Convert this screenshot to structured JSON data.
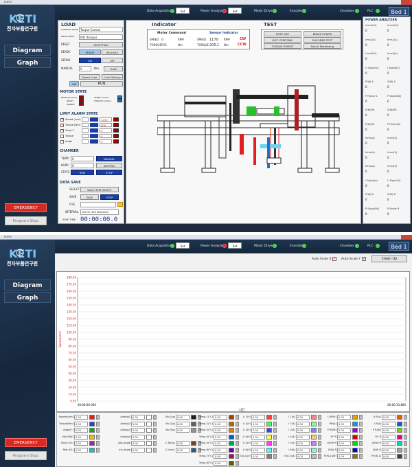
{
  "app": {
    "bed": "Bed 1"
  },
  "status": [
    {
      "label": "Data Acquisition",
      "set": "Set",
      "dot": "g"
    },
    {
      "label": "Power Analyzer",
      "set": "Set",
      "dot": "r"
    },
    {
      "label": "Motor Driver",
      "dot": "g"
    },
    {
      "label": "Encoder",
      "dot": "g"
    },
    {
      "label": "Chamber",
      "dot": "g"
    },
    {
      "label": "PLC",
      "dot": "g"
    }
  ],
  "sidebar": {
    "logo_text": "전자부품연구원",
    "diagram": "Diagram",
    "graph": "Graph",
    "emergency": "EMERGENCY",
    "program_stop": "Program Stop"
  },
  "load": {
    "title": "LOAD",
    "control_mode_label": "CONTROL MODE",
    "control_mode": "Torque Control",
    "drive_mode_label": "DRIVE MODE",
    "drive_mode": "PID (Torque)",
    "reset": "RESET",
    "resetting": "RESETTING",
    "ready": "READY",
    "ready_btn": "READY",
    "release_btn": "RELEASE",
    "servo": "SERVO",
    "on": "ON",
    "off": "OFF",
    "manual": "MANUAL",
    "manual_val": "0",
    "manual_unit": "Nm",
    "gain": "GAIN",
    "speed_limit": "Speed Limit",
    "limit_setting": "Limit Setting",
    "cw": "CW",
    "run": "RUN"
  },
  "motor_state": {
    "title": "MOTOR STATE",
    "labels": [
      "RESET(worked)",
      "READY",
      "ENABLE"
    ],
    "labels2": [
      "SPEED Control",
      "TORQUE Control"
    ]
  },
  "limit": {
    "title": "LIMIT ALARM STATE",
    "rows": [
      {
        "name": "Speed (rpm)",
        "val": "1250"
      },
      {
        "name": "Torque (Nm)",
        "val": "600"
      },
      {
        "name": "Temp.1",
        "val": "0"
      },
      {
        "name": "Torque",
        "val": "0"
      },
      {
        "name": "Angle",
        "val": "0"
      }
    ]
  },
  "chamber": {
    "title": "CHAMBER",
    "temp": "TEMP.",
    "temp_val": "0",
    "temp_btn": "MANUAL",
    "humi": "HUMI.",
    "humi_val": "0",
    "humi_btn": "SETTING",
    "stats": "STATS",
    "run": "RUN",
    "stop": "STOP"
  },
  "datasave": {
    "title": "DATA SAVE",
    "select": "SELECT",
    "select_btn": "SAVE ITEM SELECT",
    "save": "SAVE",
    "save_btn": "SAVE",
    "stop_btn": "STOP",
    "file": "FILE",
    "file_val": "",
    "interval": "INTERVAL",
    "interval_val": "100 Hz (100 Sample/S)",
    "savetime": "SAVE TIME",
    "time": "00:00:00.0"
  },
  "indicator": {
    "title": "Indicator",
    "motor_cmd": "Motor Command",
    "sensor_ind": "Sensor Indicator",
    "speed": "SPEED",
    "torque": "TORQUE",
    "m_speed": "0",
    "m_torque": "PVS",
    "rpm": "RPM",
    "nm": "Nm",
    "s_speed": "1170",
    "s_torque": "205.1",
    "cw": "CW",
    "ccw": "CCW"
  },
  "test": {
    "title": "TEST",
    "b": [
      "TEMP. SAT.",
      "BRAKE POWER",
      "MOT. PERFORM.",
      "ENCODER TEST",
      "TORQUE REPEAT",
      "Result Monitoring"
    ]
  },
  "power": {
    "title": "POWER ANALYZER",
    "items": [
      [
        "Urms1(V)",
        "Urms2(V)"
      ],
      [
        "Irms1(A)",
        "Irms2(A)"
      ],
      [
        "Urms3(V)",
        "Irms3(A)"
      ],
      [
        "U Signal(V)",
        "I Signal(V)"
      ],
      [
        "P(W) A",
        "S(W) A"
      ],
      [
        "P Factor A",
        "P Signal(W)"
      ],
      [
        "S(B)(W)",
        "S(B)(W)"
      ],
      [
        "P(B)(W)",
        "P Factor(B)"
      ],
      [
        "Ilrms(A)",
        "Urms(V)"
      ],
      [
        "Ilrms(A)",
        "Urms(V)"
      ],
      [
        "Ilrms(A)",
        "Urms(V)"
      ],
      [
        "I Signal(A)",
        "U Signal(V)"
      ],
      [
        "P(W) B",
        "S(W) B"
      ],
      [
        "P Signal(W)",
        "P Factor B"
      ]
    ],
    "zero": "0"
  },
  "graph": {
    "autox": "Auto Scale X",
    "autoy": "Auto Scale Y",
    "cleanup": "Clean Up",
    "yticks": [
      "180.00",
      "170.00",
      "160.00",
      "150.00",
      "140.00",
      "130.00",
      "120.00",
      "110.00",
      "100.00",
      "90.00",
      "80.00",
      "70.00",
      "60.00",
      "50.00",
      "40.00",
      "30.00",
      "20.00",
      "10.00",
      "0.00"
    ],
    "ylabel": "Speed(rpm)",
    "xlabel": "시간",
    "xstart": "00:00:00.000",
    "xend": "00:00:13.860"
  },
  "bottom": {
    "cols": [
      {
        "items": [
          [
            "Speed(rpm)",
            "#e02020"
          ],
          [
            "Torque(Nm)",
            "#2040e0"
          ],
          [
            "Angle(°)",
            "#20a020"
          ],
          [
            "Mot.P(W)",
            "#e0c020"
          ],
          [
            "Drive.I(%)",
            "#a020a0"
          ],
          [
            "Mot.I(%)",
            "#20c0c0"
          ]
        ]
      },
      {
        "items": [
          [
            "Analog1",
            "#ffffff"
          ],
          [
            "Analog2",
            "#ffffff"
          ],
          [
            "Analog3",
            "#ffffff"
          ],
          [
            "Analog4",
            "#ffffff"
          ],
          [
            "Abs.Angle",
            "#ffffff"
          ],
          [
            "Inc.Angle",
            "#ffffff"
          ]
        ]
      },
      {
        "items": [
          [
            "Vib.1(g)",
            "#202020"
          ],
          [
            "Vib.2(g)",
            "#606060"
          ],
          [
            "Vib.3(g)",
            "#909090"
          ],
          [
            "",
            ""
          ],
          [
            "C.Temp.",
            "#804020"
          ],
          [
            "C.Humi.",
            "#206080"
          ]
        ]
      },
      {
        "items": [
          [
            "Temp.1(°C)",
            "#a04000"
          ],
          [
            "Temp.2(°C)",
            "#c06000"
          ],
          [
            "Temp.3(°C)",
            "#e08000"
          ],
          [
            "Temp.4(°C)",
            "#0060c0"
          ],
          [
            "Temp.5(°C)",
            "#00a060"
          ],
          [
            "Temp.6(°C)",
            "#6000c0"
          ],
          [
            "Temp.7(°C)",
            "#c00060"
          ],
          [
            "Temp.8(°C)",
            "#606000"
          ]
        ]
      },
      {
        "items": [
          [
            "U 1(V)",
            "#ff4040"
          ],
          [
            "U 2(V)",
            "#40ff40"
          ],
          [
            "U 3(V)",
            "#4040ff"
          ],
          [
            "U 4(V)",
            "#ffff40"
          ],
          [
            "U 5(V)",
            "#ff40ff"
          ],
          [
            "U 6(V)",
            "#40ffff"
          ],
          [
            "I0(L1)(V)",
            "#808080"
          ]
        ]
      },
      {
        "items": [
          [
            "I 1(A)",
            "#ff8080"
          ],
          [
            "I 2(A)",
            "#80ff80"
          ],
          [
            "I 3(A)",
            "#8080ff"
          ],
          [
            "I 4(A)",
            "#ffc080"
          ],
          [
            "I 5(A)",
            "#c080ff"
          ],
          [
            "I 6(A)",
            "#80ffc0"
          ],
          [
            "I0(L1)(A)",
            "#c0c0c0"
          ]
        ]
      },
      {
        "items": [
          [
            "U Rf(V)",
            "#e0a000"
          ],
          [
            "I Rf(A)",
            "#00a0e0"
          ],
          [
            "P Rf(W)",
            "#a000e0"
          ],
          [
            "P.F R",
            "#e00000"
          ],
          [
            "U/fref R",
            "#00e000"
          ],
          [
            "S(W) R",
            "#0000e0"
          ],
          [
            "P(RL1)(W)",
            "#808000"
          ]
        ]
      },
      {
        "items": [
          [
            "U R(V)",
            "#e06000"
          ],
          [
            "I R(A)",
            "#0060e0"
          ],
          [
            "P R(W)",
            "#60e000"
          ],
          [
            "P.F R",
            "#e000a0"
          ],
          [
            "U/Iref R",
            "#00e0a0"
          ],
          [
            "S(W) R",
            "#a0a0a0"
          ],
          [
            "P.F(RL1)",
            "#404040"
          ]
        ]
      }
    ],
    "zero": "0.00"
  }
}
